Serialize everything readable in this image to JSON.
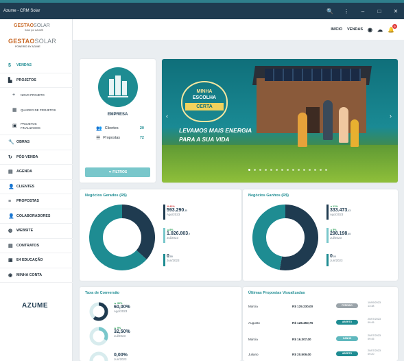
{
  "window": {
    "title": "Azume - CRM Solar",
    "controls": [
      "🔍",
      "⋮",
      "–",
      "□",
      "✕"
    ]
  },
  "brand": {
    "top_logo_main": "GESTAO",
    "top_logo_accent": "SOLAR",
    "top_logo_sub": "Solar por AZUME",
    "logo_main": "GESTAO",
    "logo_accent": "SOLAR",
    "logo_sub": "POWERED BY AZUME",
    "footer_logo": "AZUME"
  },
  "sidebar": {
    "items": [
      {
        "label": "VENDAS",
        "icon": "$"
      },
      {
        "label": "PROJETOS",
        "icon": "▙"
      },
      {
        "label": "NOVO PROJETO",
        "icon": "+"
      },
      {
        "label": "QUADRO DE PROJETOS",
        "icon": "▦"
      },
      {
        "label": "PROJETOS FINALIZADOS",
        "icon": "▣"
      },
      {
        "label": "OBRAS",
        "icon": "🔧"
      },
      {
        "label": "PÓS-VENDA",
        "icon": "↻"
      },
      {
        "label": "AGENDA",
        "icon": "▤"
      },
      {
        "label": "CLIENTES",
        "icon": "👤"
      },
      {
        "label": "PROPOSTAS",
        "icon": "≡"
      },
      {
        "label": "COLABORADORES",
        "icon": "👤"
      },
      {
        "label": "WEBSITE",
        "icon": "◍"
      },
      {
        "label": "CONTRATOS",
        "icon": "▤"
      },
      {
        "label": "E4 EDUCAÇÃO",
        "icon": "▣"
      },
      {
        "label": "MINHA CONTA",
        "icon": "◉"
      }
    ]
  },
  "topbar": {
    "inicio": "INÍCIO",
    "vendas": "VENDAS",
    "notification_count": "0",
    "icons": [
      "user-icon",
      "cloud-icon",
      "bell-icon"
    ]
  },
  "empresa": {
    "name": "EMPRESA",
    "clientes_label": "Clientes",
    "clientes_value": "20",
    "propostas_label": "Propostas",
    "propostas_value": "72",
    "filter_button": "▼ FILTROS"
  },
  "banner": {
    "seal_line1": "MINHA",
    "seal_line2": "ESCOLHA",
    "seal_ribbon": "CERTA",
    "text_line1": "LEVAMOS MAIS ENERGIA",
    "text_line2": "PARA A SUA VIDA",
    "prev": "‹",
    "next": "›"
  },
  "negocios_gerados": {
    "title": "Negócios Gerados (R$)",
    "stats": [
      {
        "change": "▼42%",
        "value": "593.290",
        "suffix": ",35",
        "period": "Ago/2023",
        "color": "#1f3b50"
      },
      {
        "change": "▲8%",
        "value": "1.026.803",
        "suffix": ",9",
        "period": "Jul/2023",
        "color": "#79c7cb"
      },
      {
        "change": "",
        "value": "0",
        "suffix": ",00",
        "period": "Jun/2023",
        "color": "#1e8c92"
      }
    ]
  },
  "negocios_ganhos": {
    "title": "Negócios Ganhos (R$)",
    "stats": [
      {
        "change": "▲11%",
        "value": "333.473",
        "suffix": ",43",
        "period": "Ago/2023",
        "color": "#1f3b50"
      },
      {
        "change": "▲5%",
        "value": "298.198",
        "suffix": ",45",
        "period": "Jul/2023",
        "color": "#79c7cb"
      },
      {
        "change": "",
        "value": "0",
        "suffix": ",00",
        "period": "Jun/2023",
        "color": "#1e8c92"
      }
    ]
  },
  "taxa_conversao": {
    "title": "Taxa de Conversão",
    "rows": [
      {
        "change": "▲ 30%",
        "pct": "60,00%",
        "period": "Ago/2023",
        "fraction": 0.6,
        "color": "#1f3b50"
      },
      {
        "change": "▲ 9%",
        "pct": "32,50%",
        "period": "Jul/2023",
        "fraction": 0.325,
        "color": "#79c7cb"
      },
      {
        "change": "",
        "pct": "0,00%",
        "period": "Jun/2023",
        "fraction": 0,
        "color": "#79c7cb"
      }
    ]
  },
  "ultimas_propostas": {
    "title": "Últimas Propostas Visualizadas",
    "rows": [
      {
        "name": "Márcia",
        "value": "R$ 129.230,00",
        "status": "PERDIDO",
        "status_color": "#9aa3a9",
        "date": "10/09/2023",
        "time": "13:38"
      },
      {
        "name": "Augusto",
        "value": "R$ 128.450,76",
        "status": "ABERTO",
        "status_color": "#1e8c92",
        "date": "20/07/2023",
        "time": "09:45"
      },
      {
        "name": "Márcia",
        "value": "R$ 16.307,00",
        "status": "GANHO",
        "status_color": "#5fb8be",
        "date": "20/07/2023",
        "time": "09:45"
      },
      {
        "name": "Juliano",
        "value": "R$ 20.509,00",
        "status": "ABERTO",
        "status_color": "#1e8c92",
        "date": "20/07/2023",
        "time": "09:20"
      }
    ]
  },
  "chart_data": [
    {
      "type": "pie",
      "title": "Negócios Gerados (R$)",
      "categories": [
        "Ago/2023",
        "Jul/2023",
        "Jun/2023"
      ],
      "values": [
        593290.35,
        1026803.9,
        0
      ],
      "colors": [
        "#1f3b50",
        "#1e8c92",
        "#79c7cb"
      ]
    },
    {
      "type": "pie",
      "title": "Negócios Ganhos (R$)",
      "categories": [
        "Ago/2023",
        "Jul/2023",
        "Jun/2023"
      ],
      "values": [
        333473.43,
        298198.45,
        0
      ],
      "colors": [
        "#1f3b50",
        "#1e8c92",
        "#79c7cb"
      ]
    }
  ]
}
